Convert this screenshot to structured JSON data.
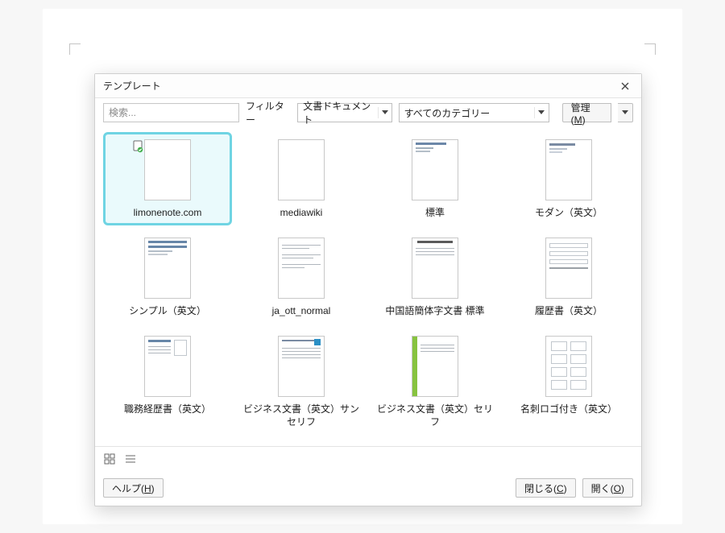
{
  "dialog": {
    "title": "テンプレート"
  },
  "toolbar": {
    "search_placeholder": "検索...",
    "filter_label": "フィルター",
    "doc_type_value": "文書ドキュメント",
    "category_value": "すべてのカテゴリー",
    "manage_label": "管理(M)"
  },
  "templates": [
    {
      "label": "limonenote.com",
      "selected": true,
      "kind": "blank",
      "badge": true
    },
    {
      "label": "mediawiki",
      "kind": "blank"
    },
    {
      "label": "標準",
      "kind": "std"
    },
    {
      "label": "モダン（英文）",
      "kind": "modern"
    },
    {
      "label": "シンプル（英文）",
      "kind": "simple"
    },
    {
      "label": "ja_ott_normal",
      "kind": "jaott"
    },
    {
      "label": "中国語簡体字文書 標準",
      "kind": "chin"
    },
    {
      "label": "履歴書（英文）",
      "kind": "form"
    },
    {
      "label": "職務経歴書（英文）",
      "kind": "resume2"
    },
    {
      "label": "ビジネス文書（英文）サンセリフ",
      "kind": "biz"
    },
    {
      "label": "ビジネス文書（英文）セリフ",
      "kind": "bizg"
    },
    {
      "label": "名刺ロゴ付き（英文）",
      "kind": "cards"
    }
  ],
  "footer": {
    "help_label": "ヘルプ(H)",
    "close_label": "閉じる(C)",
    "open_label": "開く(O)"
  }
}
